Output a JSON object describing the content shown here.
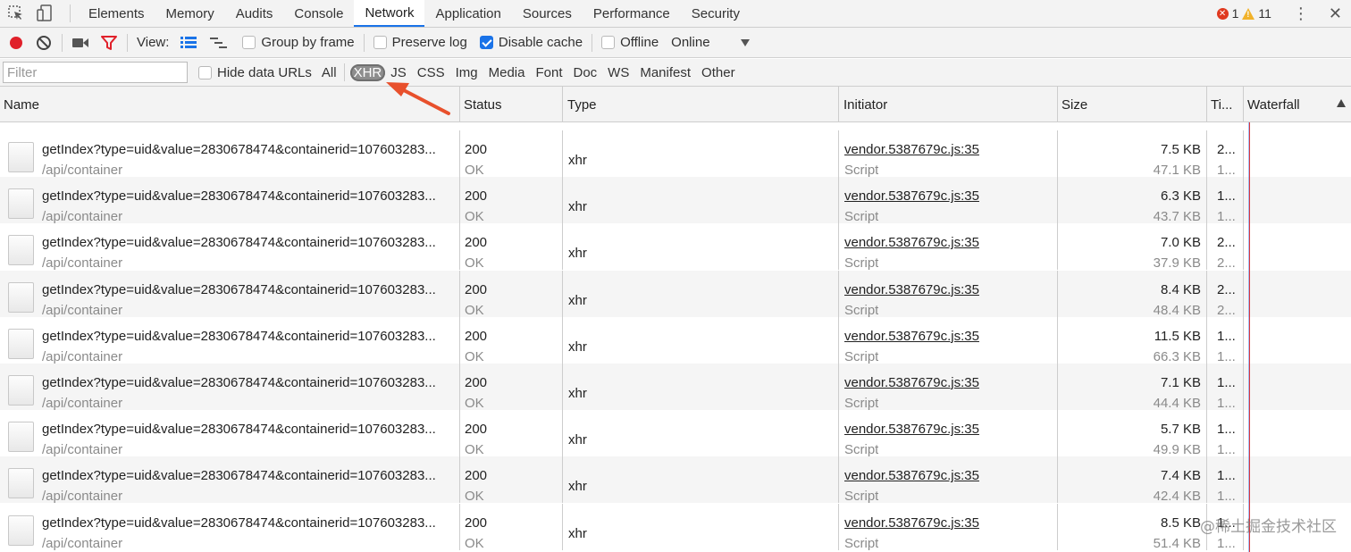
{
  "tabs": [
    "Elements",
    "Memory",
    "Audits",
    "Console",
    "Network",
    "Application",
    "Sources",
    "Performance",
    "Security"
  ],
  "active_tab": "Network",
  "counts": {
    "errors": "1",
    "warnings": "11"
  },
  "toolbar": {
    "view_label": "View:",
    "group_by_frame": "Group by frame",
    "preserve_log": "Preserve log",
    "disable_cache": "Disable cache",
    "offline": "Offline",
    "throttle": "Online"
  },
  "filter": {
    "placeholder": "Filter",
    "hide_data_urls": "Hide data URLs",
    "types": [
      "All",
      "XHR",
      "JS",
      "CSS",
      "Img",
      "Media",
      "Font",
      "Doc",
      "WS",
      "Manifest",
      "Other"
    ],
    "active_type": "XHR"
  },
  "columns": {
    "name": "Name",
    "status": "Status",
    "type": "Type",
    "initiator": "Initiator",
    "size": "Size",
    "time": "Ti...",
    "waterfall": "Waterfall"
  },
  "requests": [
    {
      "name": "getIndex?type=uid&value=2830678474&containerid=107603283...",
      "path": "/api/container",
      "status": "200",
      "status_text": "OK",
      "type": "xhr",
      "initiator": "vendor.5387679c.js:35",
      "initiator_type": "Script",
      "size": "7.5 KB",
      "content": "47.1 KB",
      "time1": "2...",
      "time2": "1..."
    },
    {
      "name": "getIndex?type=uid&value=2830678474&containerid=107603283...",
      "path": "/api/container",
      "status": "200",
      "status_text": "OK",
      "type": "xhr",
      "initiator": "vendor.5387679c.js:35",
      "initiator_type": "Script",
      "size": "6.3 KB",
      "content": "43.7 KB",
      "time1": "1...",
      "time2": "1..."
    },
    {
      "name": "getIndex?type=uid&value=2830678474&containerid=107603283...",
      "path": "/api/container",
      "status": "200",
      "status_text": "OK",
      "type": "xhr",
      "initiator": "vendor.5387679c.js:35",
      "initiator_type": "Script",
      "size": "7.0 KB",
      "content": "37.9 KB",
      "time1": "2...",
      "time2": "2..."
    },
    {
      "name": "getIndex?type=uid&value=2830678474&containerid=107603283...",
      "path": "/api/container",
      "status": "200",
      "status_text": "OK",
      "type": "xhr",
      "initiator": "vendor.5387679c.js:35",
      "initiator_type": "Script",
      "size": "8.4 KB",
      "content": "48.4 KB",
      "time1": "2...",
      "time2": "2..."
    },
    {
      "name": "getIndex?type=uid&value=2830678474&containerid=107603283...",
      "path": "/api/container",
      "status": "200",
      "status_text": "OK",
      "type": "xhr",
      "initiator": "vendor.5387679c.js:35",
      "initiator_type": "Script",
      "size": "11.5 KB",
      "content": "66.3 KB",
      "time1": "1...",
      "time2": "1..."
    },
    {
      "name": "getIndex?type=uid&value=2830678474&containerid=107603283...",
      "path": "/api/container",
      "status": "200",
      "status_text": "OK",
      "type": "xhr",
      "initiator": "vendor.5387679c.js:35",
      "initiator_type": "Script",
      "size": "7.1 KB",
      "content": "44.4 KB",
      "time1": "1...",
      "time2": "1..."
    },
    {
      "name": "getIndex?type=uid&value=2830678474&containerid=107603283...",
      "path": "/api/container",
      "status": "200",
      "status_text": "OK",
      "type": "xhr",
      "initiator": "vendor.5387679c.js:35",
      "initiator_type": "Script",
      "size": "5.7 KB",
      "content": "49.9 KB",
      "time1": "1...",
      "time2": "1..."
    },
    {
      "name": "getIndex?type=uid&value=2830678474&containerid=107603283...",
      "path": "/api/container",
      "status": "200",
      "status_text": "OK",
      "type": "xhr",
      "initiator": "vendor.5387679c.js:35",
      "initiator_type": "Script",
      "size": "7.4 KB",
      "content": "42.4 KB",
      "time1": "1...",
      "time2": "1..."
    },
    {
      "name": "getIndex?type=uid&value=2830678474&containerid=107603283...",
      "path": "/api/container",
      "status": "200",
      "status_text": "OK",
      "type": "xhr",
      "initiator": "vendor.5387679c.js:35",
      "initiator_type": "Script",
      "size": "8.5 KB",
      "content": "51.4 KB",
      "time1": "1...",
      "time2": "1..."
    }
  ],
  "watermark": "@稀土掘金技术社区",
  "colors": {
    "record": "#e0202a",
    "accent": "#1a73e8",
    "arrow": "#e8502c",
    "waterfall_marker": "#d9363e"
  }
}
